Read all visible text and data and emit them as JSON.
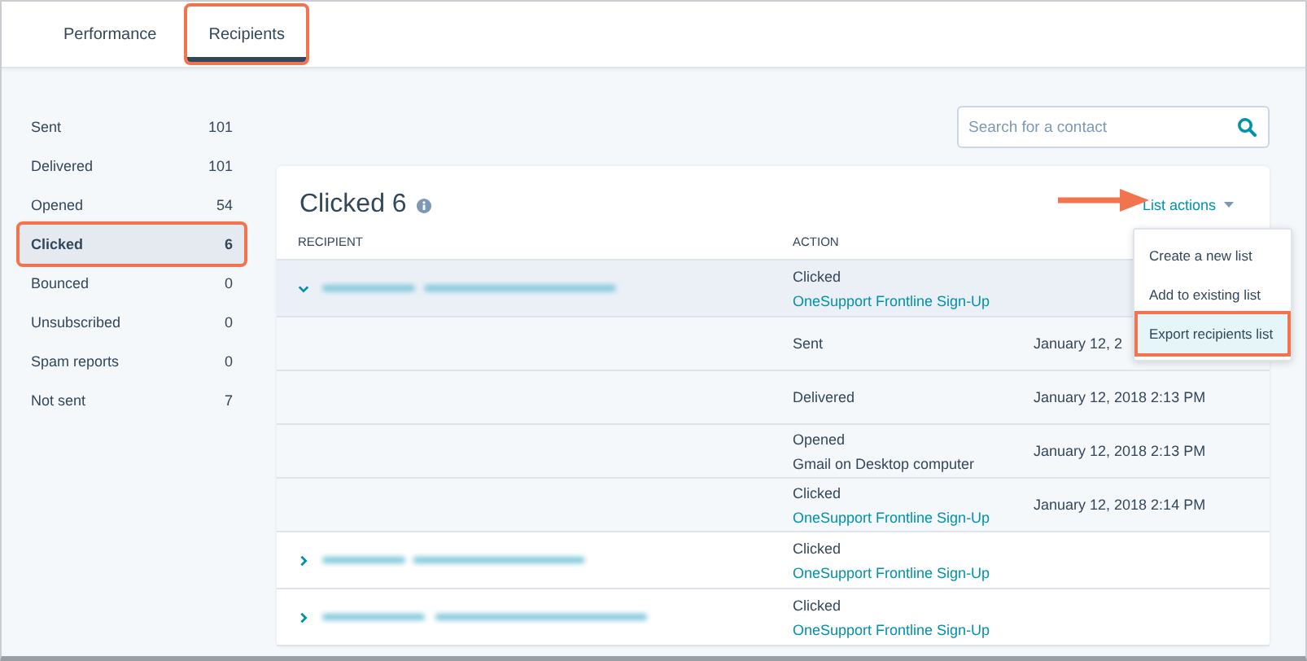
{
  "tabs": [
    {
      "label": "Performance",
      "selected": false,
      "annotated": false
    },
    {
      "label": "Recipients",
      "selected": true,
      "annotated": true
    }
  ],
  "sidebar": {
    "items": [
      {
        "label": "Sent",
        "count": "101",
        "selected": false,
        "annotated": false
      },
      {
        "label": "Delivered",
        "count": "101",
        "selected": false,
        "annotated": false
      },
      {
        "label": "Opened",
        "count": "54",
        "selected": false,
        "annotated": false
      },
      {
        "label": "Clicked",
        "count": "6",
        "selected": true,
        "annotated": true
      },
      {
        "label": "Bounced",
        "count": "0",
        "selected": false,
        "annotated": false
      },
      {
        "label": "Unsubscribed",
        "count": "0",
        "selected": false,
        "annotated": false
      },
      {
        "label": "Spam reports",
        "count": "0",
        "selected": false,
        "annotated": false
      },
      {
        "label": "Not sent",
        "count": "7",
        "selected": false,
        "annotated": false
      }
    ]
  },
  "search": {
    "placeholder": "Search for a contact"
  },
  "card": {
    "title": "Clicked 6",
    "list_actions": {
      "label": "List actions",
      "expanded": true,
      "menu": [
        {
          "label": "Create a new list",
          "annotated": false
        },
        {
          "label": "Add to existing list",
          "annotated": false
        },
        {
          "label": "Export recipients list",
          "annotated": true
        }
      ]
    },
    "columns": [
      "RECIPIENT",
      "ACTION"
    ],
    "rows": [
      {
        "expanded": true,
        "action": "Clicked",
        "detail": {
          "kind": "link",
          "text": "OneSupport Frontline Sign-Up"
        },
        "children": [
          {
            "action": "Sent",
            "date": "January 12, 2"
          },
          {
            "action": "Delivered",
            "date": "January 12, 2018 2:13 PM"
          },
          {
            "action": "Opened",
            "detail": {
              "kind": "plain",
              "text": "Gmail on Desktop computer"
            },
            "date": "January 12, 2018 2:13 PM"
          },
          {
            "action": "Clicked",
            "detail": {
              "kind": "link",
              "text": "OneSupport Frontline Sign-Up"
            },
            "date": "January 12, 2018 2:14 PM"
          }
        ]
      },
      {
        "expanded": false,
        "action": "Clicked",
        "detail": {
          "kind": "link",
          "text": "OneSupport Frontline Sign-Up"
        }
      },
      {
        "expanded": false,
        "action": "Clicked",
        "detail": {
          "kind": "link",
          "text": "OneSupport Frontline Sign-Up"
        }
      }
    ]
  }
}
